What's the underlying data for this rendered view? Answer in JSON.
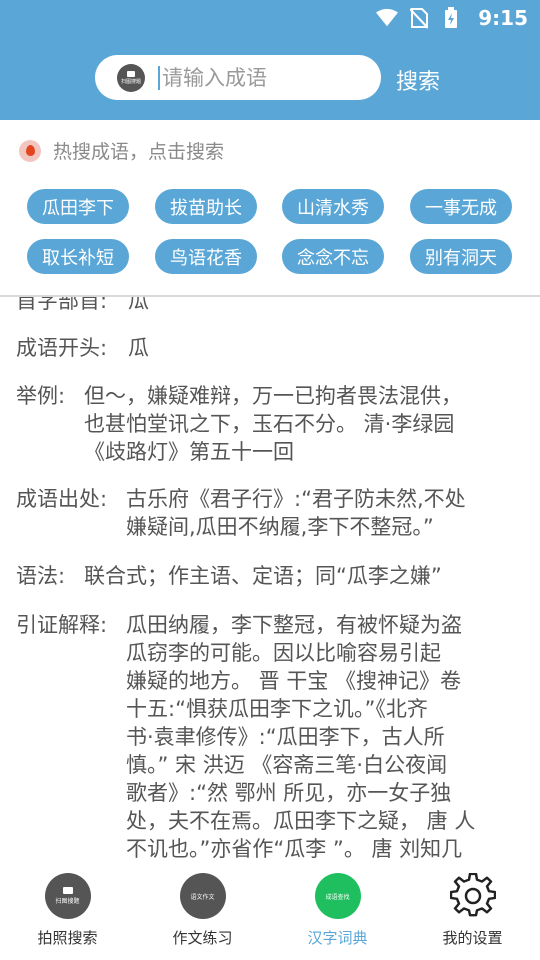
{
  "status_bar": {
    "time": "9:15"
  },
  "search": {
    "placeholder": "请输入成语",
    "logo_text": "扫图搜题",
    "button_label": "搜索"
  },
  "hot": {
    "title": "热搜成语，点击搜索",
    "chips": [
      "瓜田李下",
      "拔苗助长",
      "山清水秀",
      "一事无成",
      "取长补短",
      "鸟语花香",
      "念念不忘",
      "别有洞天"
    ]
  },
  "content": {
    "partial_label": "首字部首:",
    "partial_value": "瓜",
    "start": {
      "label": "成语开头:",
      "value": "瓜"
    },
    "example": {
      "label": "举例:",
      "lines": [
        "但～，嫌疑难辩，万一已拘者畏法混供，",
        "也甚怕堂讯之下，玉石不分。 清·李绿园",
        "《歧路灯》第五十一回"
      ]
    },
    "source": {
      "label": "成语出处:",
      "lines": [
        "古乐府《君子行》:“君子防未然,不处",
        "嫌疑间,瓜田不纳履,李下不整冠。”"
      ]
    },
    "grammar": {
      "label": "语法:",
      "value": "联合式；作主语、定语；同“瓜李之嫌”"
    },
    "citation": {
      "label": "引证解释:",
      "lines": [
        "瓜田纳履，李下整冠，有被怀疑为盗",
        "瓜窃李的可能。因以比喻容易引起",
        "嫌疑的地方。 晋 干宝 《搜神记》卷",
        "十五:“惧获瓜田李下之讥。”《北齐",
        "书·袁聿修传》:“瓜田李下，古人所",
        "慎。” 宋 洪迈 《容斋三笔·白公夜闻",
        "歌者》:“然 鄂州 所见，亦一女子独",
        "处，夫不在焉。瓜田李下之疑， 唐 人",
        "不讥也。”亦省作“瓜李 ”。 唐 刘知几"
      ]
    }
  },
  "nav": {
    "items": [
      {
        "label": "拍照搜索",
        "icon_text": "扫图搜题"
      },
      {
        "label": "作文练习",
        "icon_text": "语文作文"
      },
      {
        "label": "汉字词典",
        "icon_text": "成语查找"
      },
      {
        "label": "我的设置"
      }
    ]
  },
  "colors": {
    "accent": "#5aa7d7",
    "active_nav": "#1fbf5f",
    "icon_gray": "#555555"
  }
}
